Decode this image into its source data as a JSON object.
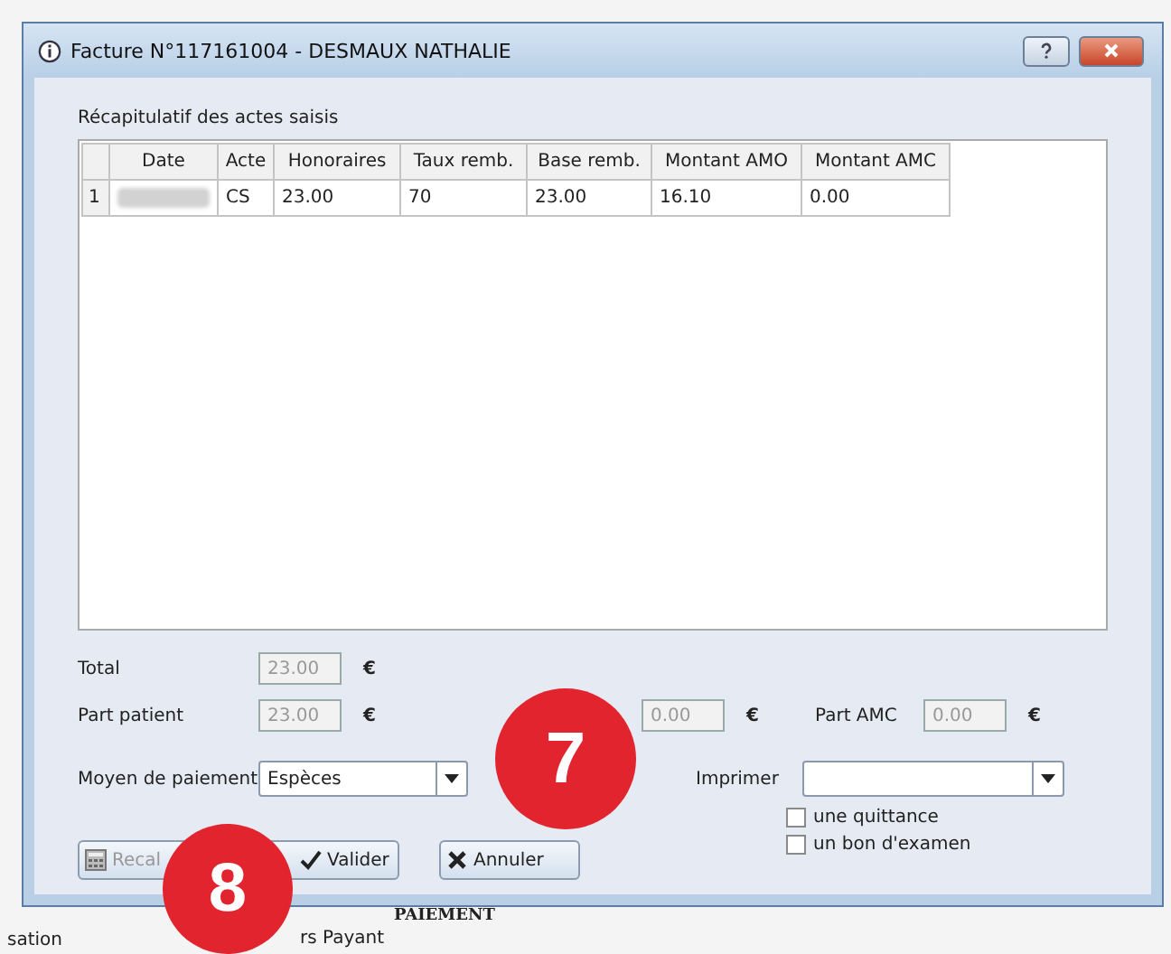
{
  "window": {
    "title": "Facture N°117161004 - DESMAUX NATHALIE"
  },
  "summary": {
    "heading": "Récapitulatif des actes saisis",
    "columns": [
      "Date",
      "Acte",
      "Honoraires",
      "Taux remb.",
      "Base remb.",
      "Montant AMO",
      "Montant AMC"
    ],
    "rows": [
      {
        "index": "1",
        "cells": [
          "",
          "CS",
          "23.00",
          "70",
          "23.00",
          "16.10",
          "0.00"
        ]
      }
    ]
  },
  "totals": {
    "total_label": "Total",
    "total_value": "23.00",
    "currency": "€",
    "patient_label": "Part patient",
    "patient_value": "23.00",
    "amo_value": "0.00",
    "amc_label": "Part AMC",
    "amc_value": "0.00"
  },
  "payment": {
    "label": "Moyen de paiement",
    "value": "Espèces"
  },
  "print": {
    "label": "Imprimer",
    "options": [
      {
        "label": "une quittance",
        "checked": false
      },
      {
        "label": "un bon d'examen",
        "checked": false
      }
    ]
  },
  "buttons": [
    {
      "kind": "recalc",
      "label": "Recal",
      "disabled": true
    },
    {
      "kind": "validate",
      "label": "Valider",
      "disabled": false
    },
    {
      "kind": "cancel",
      "label": "Annuler",
      "disabled": false
    }
  ],
  "badges": [
    {
      "label": "7"
    },
    {
      "label": "8"
    }
  ],
  "background": {
    "section": "PAIEMENT",
    "left_text": "sation",
    "right_text": "rs Payant"
  }
}
